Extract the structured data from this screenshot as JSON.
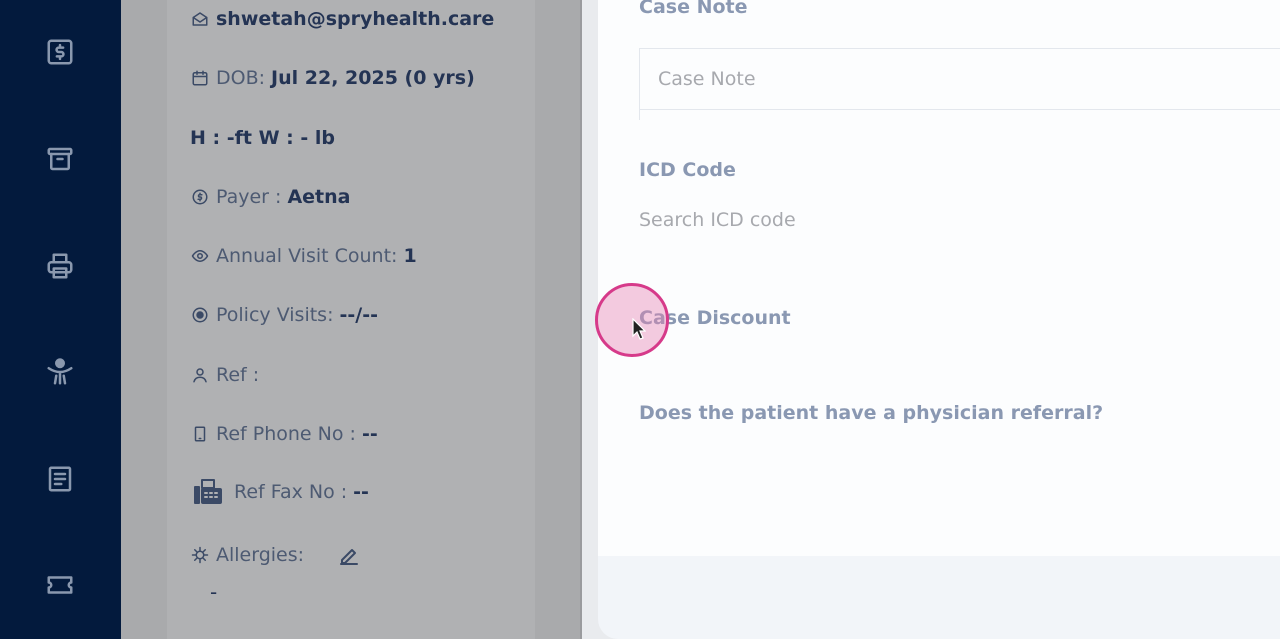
{
  "nav": {
    "items": [
      {
        "icon": "billing-icon"
      },
      {
        "icon": "archive-icon"
      },
      {
        "icon": "printer-icon"
      },
      {
        "icon": "exercise-icon"
      },
      {
        "icon": "document-icon"
      },
      {
        "icon": "ticket-icon"
      }
    ]
  },
  "patient": {
    "email": "shwetah@spryhealth.care",
    "dob_label": "DOB:",
    "dob_value": "Jul 22, 2025 (0 yrs)",
    "height_weight": "H : -ft W : - lb",
    "payer_label": "Payer :",
    "payer_value": "Aetna",
    "visit_count_label": "Annual Visit Count:",
    "visit_count_value": "1",
    "policy_visits_label": "Policy Visits:",
    "policy_visits_value": "--/--",
    "ref_label": "Ref :",
    "ref_value": "",
    "ref_phone_label": "Ref Phone No :",
    "ref_phone_value": "--",
    "ref_fax_label": "Ref Fax No :",
    "ref_fax_value": "--",
    "allergies_label": "Allergies:",
    "allergies_value": "-"
  },
  "case_form": {
    "case_note_label": "Case Note",
    "case_note_placeholder": "Case Note",
    "icd_label": "ICD Code",
    "icd_placeholder": "Search ICD code",
    "discount_label": "Case Discount",
    "referral_question": "Does the patient have a physician referral?"
  },
  "colors": {
    "nav_bg": "#031a3d",
    "label": "#8a98b2",
    "click_indicator": "#d63a8a"
  }
}
